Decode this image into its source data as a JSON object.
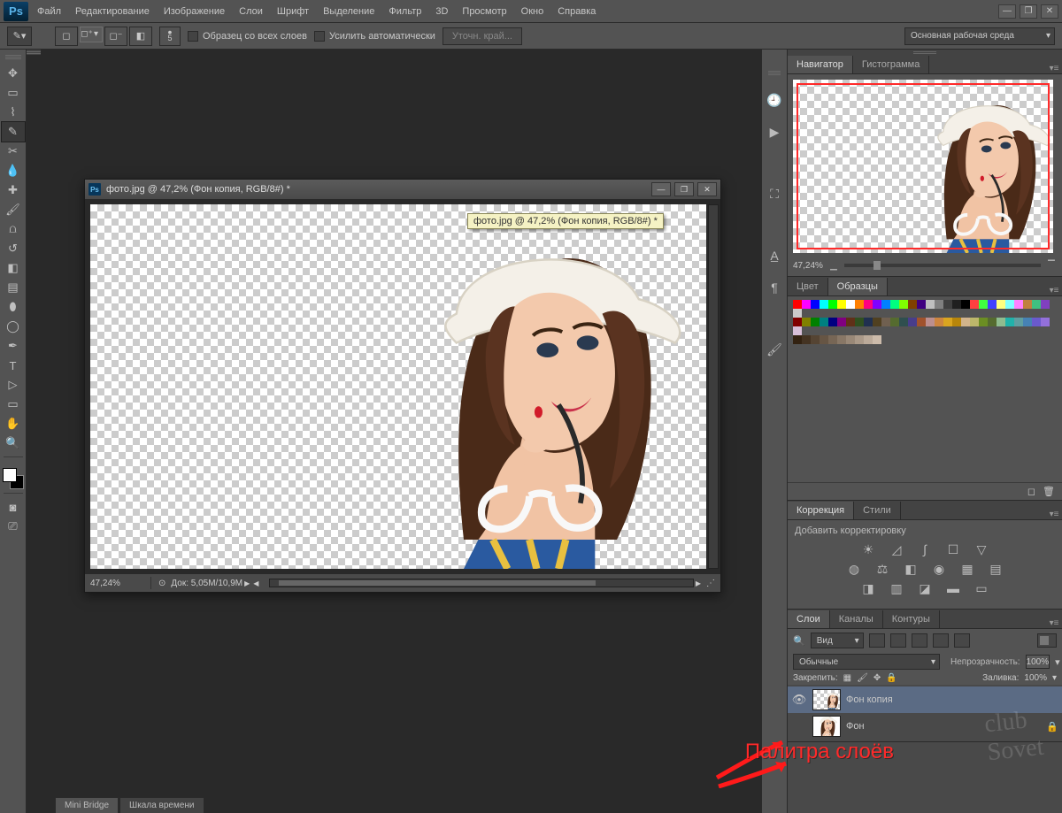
{
  "menu": {
    "items": [
      "Файл",
      "Редактирование",
      "Изображение",
      "Слои",
      "Шрифт",
      "Выделение",
      "Фильтр",
      "3D",
      "Просмотр",
      "Окно",
      "Справка"
    ]
  },
  "optionsbar": {
    "brush_size": "5",
    "sample_all": "Образец со всех слоев",
    "auto_enhance": "Усилить автоматически",
    "refine_edge": "Уточн. край...",
    "workspace": "Основная рабочая среда"
  },
  "document": {
    "title": "фото.jpg @ 47,2% (Фон копия, RGB/8#) *",
    "tooltip": "фото.jpg @ 47,2% (Фон копия, RGB/8#) *",
    "status_zoom": "47,24%",
    "status_doc": "Док: 5,05M/10,9M"
  },
  "panel_navigator": {
    "tabs": [
      "Навигатор",
      "Гистограмма"
    ],
    "zoom": "47,24%"
  },
  "panel_color": {
    "tabs": [
      "Цвет",
      "Образцы"
    ]
  },
  "panel_correction": {
    "tabs": [
      "Коррекция",
      "Стили"
    ],
    "add_label": "Добавить корректировку"
  },
  "panel_layers": {
    "tabs": [
      "Слои",
      "Каналы",
      "Контуры"
    ],
    "filter_kind": "Вид",
    "blend_mode": "Обычные",
    "opacity_label": "Непрозрачность:",
    "opacity_value": "100%",
    "lock_label": "Закрепить:",
    "fill_label": "Заливка:",
    "fill_value": "100%",
    "layers": [
      {
        "name": "Фон копия",
        "visible": true,
        "selected": true,
        "locked": false
      },
      {
        "name": "Фон",
        "visible": false,
        "selected": false,
        "locked": true
      }
    ]
  },
  "bottom_tabs": [
    "Mini Bridge",
    "Шкала времени"
  ],
  "annotation": "Палитра слоёв",
  "swatch_colors_row1": [
    "#ff0000",
    "#ff00ff",
    "#0000ff",
    "#00ffff",
    "#00ff00",
    "#ffff00",
    "#ffffff",
    "#ff8000",
    "#ff0080",
    "#8000ff",
    "#0080ff",
    "#00ff80",
    "#80ff00",
    "#804000",
    "#400080",
    "#c0c0c0",
    "#808080",
    "#404040",
    "#202020",
    "#000000",
    "#ff4040",
    "#40ff40",
    "#4040ff",
    "#ffff80",
    "#80ffff",
    "#ff80ff",
    "#c08040",
    "#40c080",
    "#8040c0",
    "#cccccc"
  ],
  "swatch_colors_row2": [
    "#800000",
    "#808000",
    "#008000",
    "#008080",
    "#000080",
    "#800080",
    "#603018",
    "#305020",
    "#203050",
    "#504020",
    "#706050",
    "#556b2f",
    "#2f4f4f",
    "#483d8b",
    "#a0522d",
    "#bc8f8f",
    "#cd853f",
    "#daa520",
    "#b8860b",
    "#d2b48c",
    "#bdb76b",
    "#6b8e23",
    "#556b2f",
    "#8fbc8f",
    "#20b2aa",
    "#5f9ea0",
    "#4682b4",
    "#6a5acd",
    "#9370db",
    "#d8bfd8"
  ],
  "swatch_colors_row3": [
    "#332211",
    "#443322",
    "#554433",
    "#665544",
    "#776655",
    "#887766",
    "#998877",
    "#aa9988",
    "#bbaa99",
    "#ccbbaa"
  ]
}
